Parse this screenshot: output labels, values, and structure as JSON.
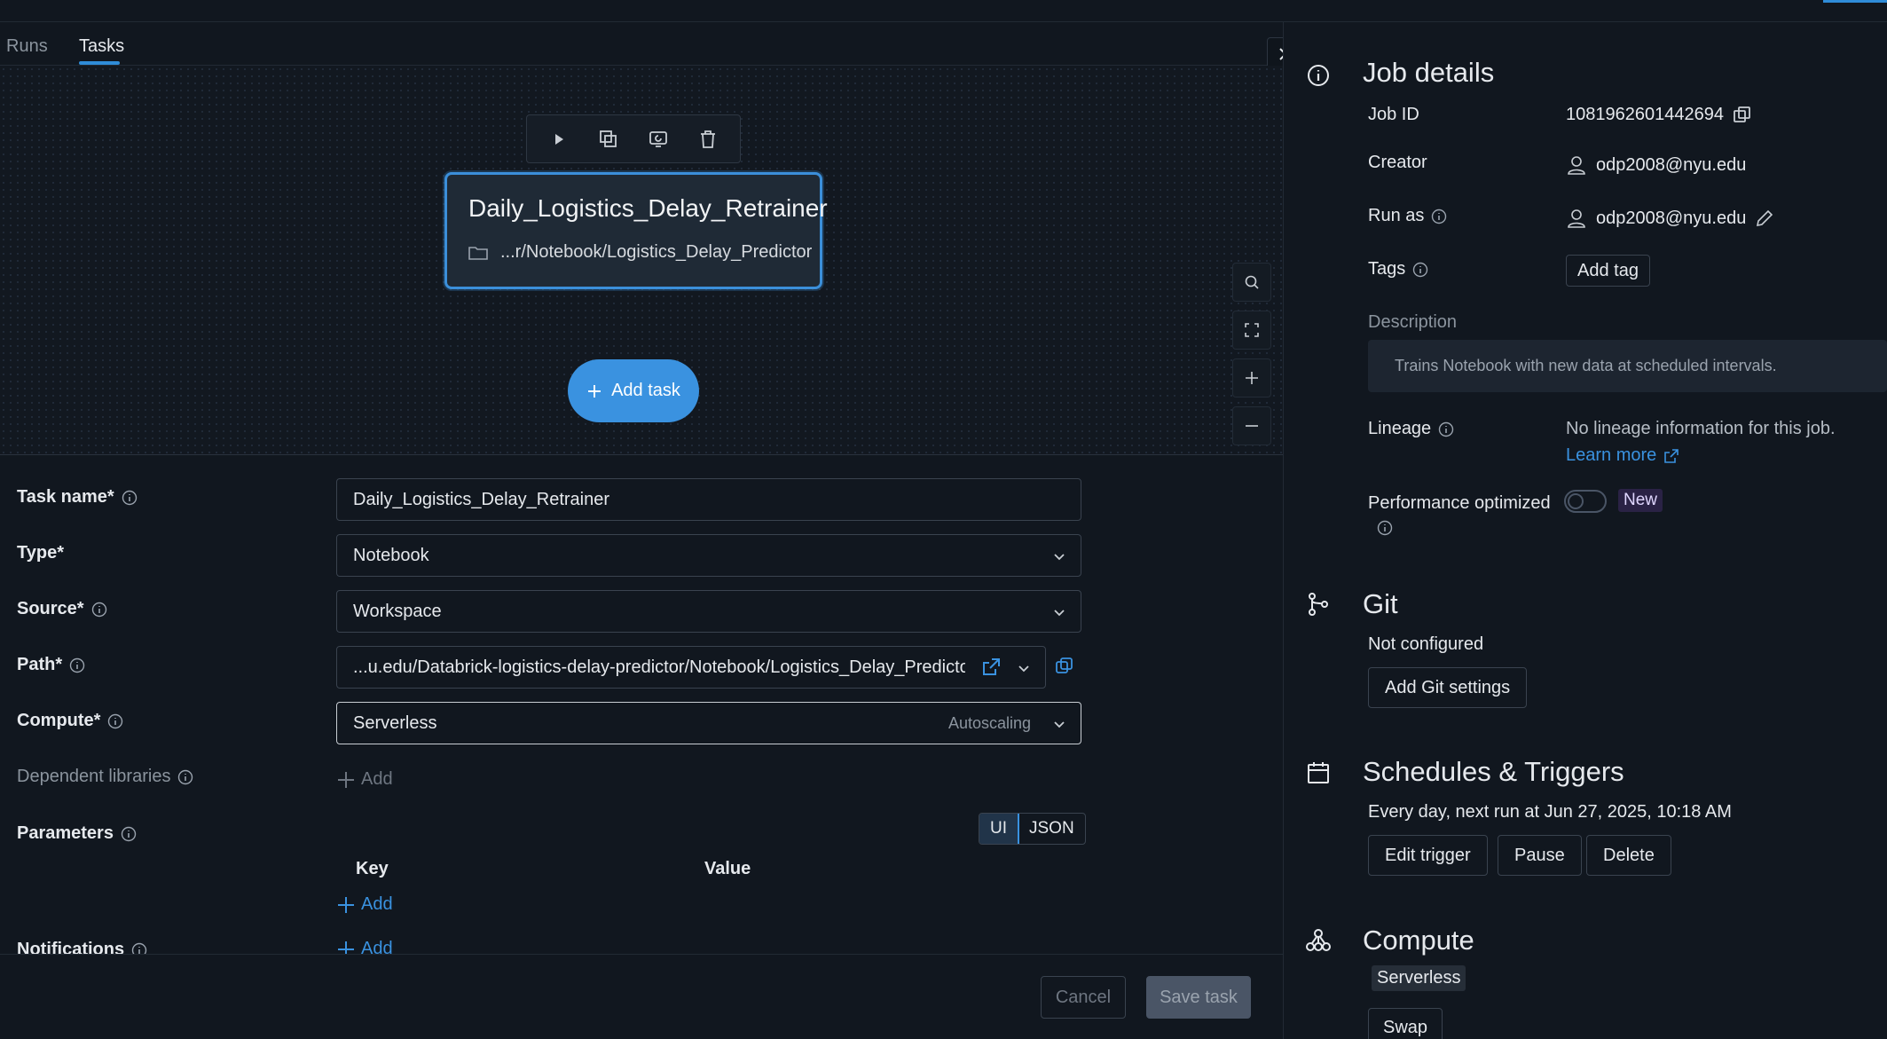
{
  "tabs": [
    {
      "label": "Runs"
    },
    {
      "label": "Tasks"
    }
  ],
  "node": {
    "title": "Daily_Logistics_Delay_Retrainer",
    "path": "...r/Notebook/Logistics_Delay_Predictor",
    "toolbar_icons": [
      "play-icon",
      "duplicate-icon",
      "repair-icon",
      "delete-icon"
    ]
  },
  "canvas": {
    "add_task_label": "Add task",
    "zoom_controls": [
      "search-icon",
      "fit-view-icon",
      "zoom-in-icon",
      "zoom-out-icon"
    ]
  },
  "form": {
    "task_name": {
      "label": "Task name*",
      "value": "Daily_Logistics_Delay_Retrainer"
    },
    "type": {
      "label": "Type*",
      "value": "Notebook"
    },
    "source": {
      "label": "Source*",
      "value": "Workspace"
    },
    "path": {
      "label": "Path*",
      "value": "...u.edu/Databrick-logistics-delay-predictor/Notebook/Logistics_Delay_Predictor"
    },
    "compute": {
      "label": "Compute*",
      "value": "Serverless",
      "hint": "Autoscaling"
    },
    "dependent_libraries": {
      "label": "Dependent libraries",
      "add_label": "Add"
    },
    "parameters": {
      "label": "Parameters",
      "modes": [
        "UI",
        "JSON"
      ],
      "active_mode": "UI",
      "key_header": "Key",
      "value_header": "Value",
      "add_label": "Add"
    },
    "notifications": {
      "label": "Notifications",
      "add_label": "Add"
    }
  },
  "footer": {
    "cancel_label": "Cancel",
    "save_label": "Save task"
  },
  "job_details": {
    "title": "Job details",
    "job_id_label": "Job ID",
    "job_id": "1081962601442694",
    "creator_label": "Creator",
    "creator": "odp2008@nyu.edu",
    "run_as_label": "Run as",
    "run_as": "odp2008@nyu.edu",
    "tags_label": "Tags",
    "add_tag_label": "Add tag",
    "description_label": "Description",
    "description": "Trains Notebook with new data at scheduled intervals.",
    "lineage_label": "Lineage",
    "lineage_text": "No lineage information for this job.",
    "learn_more": "Learn more",
    "performance_label": "Performance optimized",
    "performance_on": false,
    "new_badge": "New"
  },
  "git": {
    "title": "Git",
    "status": "Not configured",
    "button": "Add Git settings"
  },
  "schedules": {
    "title": "Schedules & Triggers",
    "text": "Every day, next run at Jun 27, 2025, 10:18 AM",
    "edit_label": "Edit trigger",
    "pause_label": "Pause",
    "delete_label": "Delete"
  },
  "compute_section": {
    "title": "Compute",
    "value": "Serverless",
    "swap_label": "Swap"
  },
  "colors": {
    "accent": "#3a92e0",
    "background": "#11171f",
    "node_border": "#3b8fda"
  }
}
